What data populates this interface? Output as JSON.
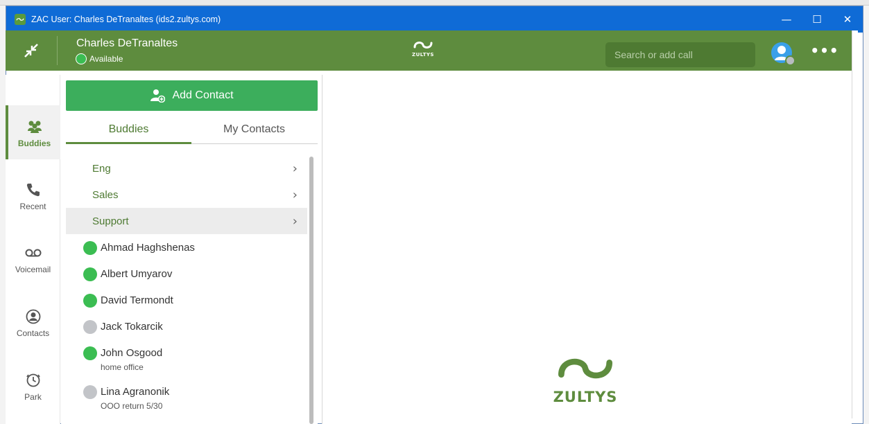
{
  "window": {
    "title": "ZAC User: Charles DeTranaltes (ids2.zultys.com)",
    "controls": {
      "minimize": "—",
      "maximize": "☐",
      "close": "✕"
    }
  },
  "header": {
    "user_name": "Charles DeTranaltes",
    "status": "Available",
    "logo_text": "ZULTYS",
    "search_placeholder": "Search or add call",
    "more_label": "•••"
  },
  "rail": {
    "items": [
      {
        "label": "Buddies",
        "icon": "users-icon",
        "active": true
      },
      {
        "label": "Recent",
        "icon": "phone-icon",
        "active": false
      },
      {
        "label": "Voicemail",
        "icon": "voicemail-icon",
        "active": false
      },
      {
        "label": "Contacts",
        "icon": "contact-person-icon",
        "active": false
      },
      {
        "label": "Park",
        "icon": "clock-icon",
        "active": false
      }
    ]
  },
  "contacts_panel": {
    "add_contact_label": "Add Contact",
    "tabs": [
      {
        "label": "Buddies",
        "active": true
      },
      {
        "label": "My Contacts",
        "active": false
      }
    ],
    "groups": [
      {
        "name": "Eng",
        "highlighted": false
      },
      {
        "name": "Sales",
        "highlighted": false
      },
      {
        "name": "Support",
        "highlighted": true
      }
    ],
    "contacts": [
      {
        "name": "Ahmad Haghshenas",
        "note": "",
        "status": "online"
      },
      {
        "name": "Albert Umyarov",
        "note": "",
        "status": "online"
      },
      {
        "name": "David Termondt",
        "note": "",
        "status": "online"
      },
      {
        "name": "Jack Tokarcik",
        "note": "",
        "status": "offline"
      },
      {
        "name": "John Osgood",
        "note": "home office",
        "status": "online"
      },
      {
        "name": "Lina Agranonik",
        "note": "OOO return 5/30",
        "status": "offline"
      }
    ]
  },
  "detail": {
    "logo_text": "ZULTYS"
  },
  "colors": {
    "titlebar": "#0f6bd6",
    "header_green": "#5e8c3e",
    "accent_green": "#3cae5c",
    "online": "#3bbd52",
    "offline": "#c2c4c8"
  }
}
